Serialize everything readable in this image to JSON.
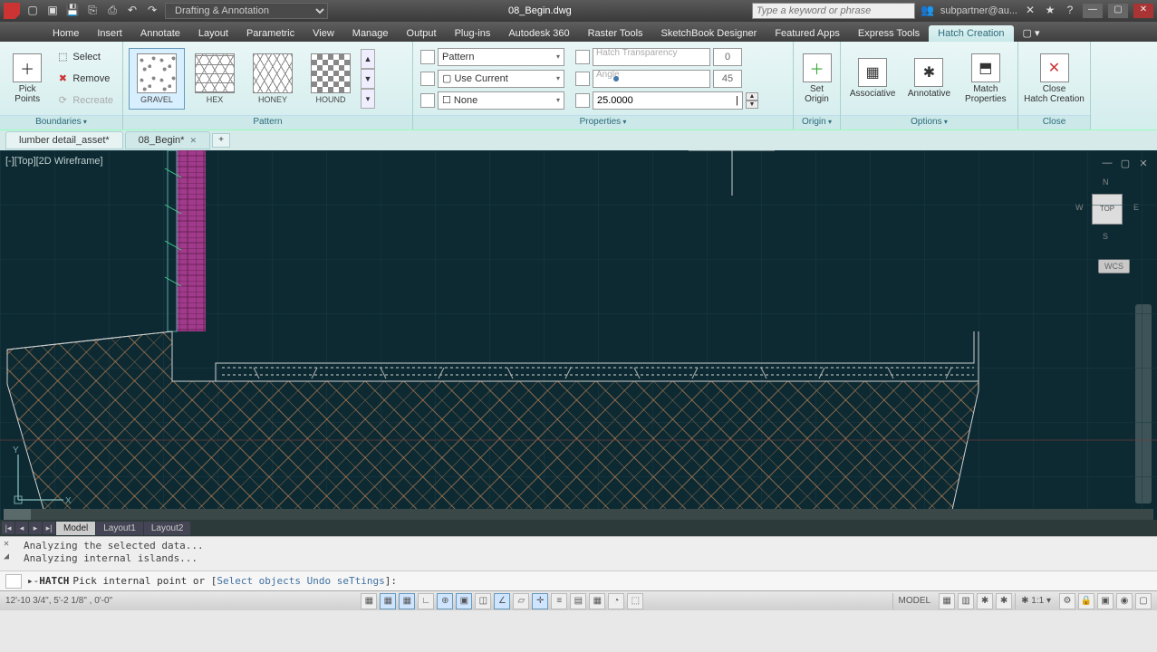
{
  "title": "08_Begin.dwg",
  "workspace": "Drafting & Annotation",
  "search_placeholder": "Type a keyword or phrase",
  "user": "subpartner@au...",
  "tabs": [
    "Home",
    "Insert",
    "Annotate",
    "Layout",
    "Parametric",
    "View",
    "Manage",
    "Output",
    "Plug-ins",
    "Autodesk 360",
    "Raster Tools",
    "SketchBook Designer",
    "Featured Apps",
    "Express Tools",
    "Hatch Creation"
  ],
  "active_tab": "Hatch Creation",
  "panels": {
    "boundaries": {
      "title": "Boundaries",
      "pick_points": "Pick Points",
      "select": "Select",
      "remove": "Remove",
      "recreate": "Recreate"
    },
    "pattern": {
      "title": "Pattern",
      "items": [
        {
          "label": "GRAVEL",
          "cls": "gravel",
          "sel": true
        },
        {
          "label": "HEX",
          "cls": "hex"
        },
        {
          "label": "HONEY",
          "cls": "honey"
        },
        {
          "label": "HOUND",
          "cls": "hound"
        }
      ]
    },
    "properties": {
      "title": "Properties",
      "pattern_type": "Pattern",
      "color": "Use Current",
      "bg": "None",
      "transparency_label": "Hatch Transparency",
      "transparency": "0",
      "angle_label": "Angle",
      "angle": "45",
      "scale": "25.0000"
    },
    "origin": {
      "title": "Origin",
      "set_origin": "Set\nOrigin"
    },
    "options": {
      "title": "Options",
      "associative": "Associative",
      "annotative": "Annotative",
      "match": "Match\nProperties"
    },
    "close": {
      "title": "Close",
      "close_hatch": "Close\nHatch Creation"
    }
  },
  "file_tabs": [
    {
      "name": "lumber detail_asset*",
      "active": false
    },
    {
      "name": "08_Begin*",
      "active": true
    }
  ],
  "viewport_label": "[-][Top][2D Wireframe]",
  "viewcube": {
    "face": "TOP",
    "n": "N",
    "s": "S",
    "e": "E",
    "w": "W",
    "wcs": "WCS"
  },
  "layout_tabs": [
    "Model",
    "Layout1",
    "Layout2"
  ],
  "cmd_log": [
    "Analyzing the selected data...",
    "Analyzing internal islands..."
  ],
  "cmd": {
    "name": "HATCH",
    "prompt": "Pick internal point or [",
    "opts": [
      "Select objects",
      "Undo",
      "seTtings"
    ],
    "end": "]:"
  },
  "status": {
    "coords": "12'-10 3/4\", 5'-2 1/8\" , 0'-0\"",
    "model": "MODEL",
    "scale": "1:1"
  },
  "ucs": {
    "y": "Y",
    "x": "X"
  }
}
